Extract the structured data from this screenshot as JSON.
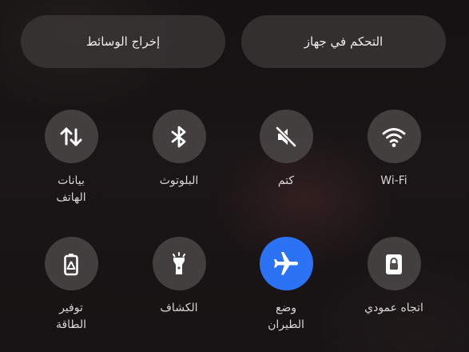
{
  "top_buttons": {
    "media_output": "إخراج الوسائط",
    "device_control": "التحكم في جهاز"
  },
  "tiles": {
    "mobile_data": {
      "label": "بيانات\nالهاتف",
      "icon": "arrows-up-down-icon",
      "active": false
    },
    "bluetooth": {
      "label": "البلوتوث",
      "icon": "bluetooth-icon",
      "active": false
    },
    "mute": {
      "label": "كتم",
      "icon": "speaker-muted-icon",
      "active": false
    },
    "wifi": {
      "label": "Wi-Fi",
      "icon": "wifi-icon",
      "active": false
    },
    "battery_saver": {
      "label": "توفير\nالطاقة",
      "icon": "battery-saver-icon",
      "active": false
    },
    "flashlight": {
      "label": "الكشاف",
      "icon": "flashlight-icon",
      "active": false
    },
    "airplane_mode": {
      "label": "وضع\nالطيران",
      "icon": "airplane-icon",
      "active": true
    },
    "portrait_lock": {
      "label": "اتجاه عمودي",
      "icon": "portrait-lock-icon",
      "active": false
    }
  },
  "colors": {
    "active_tile": "#2b72f5",
    "inactive_tile": "#504c4c",
    "icon": "#ffffff"
  }
}
